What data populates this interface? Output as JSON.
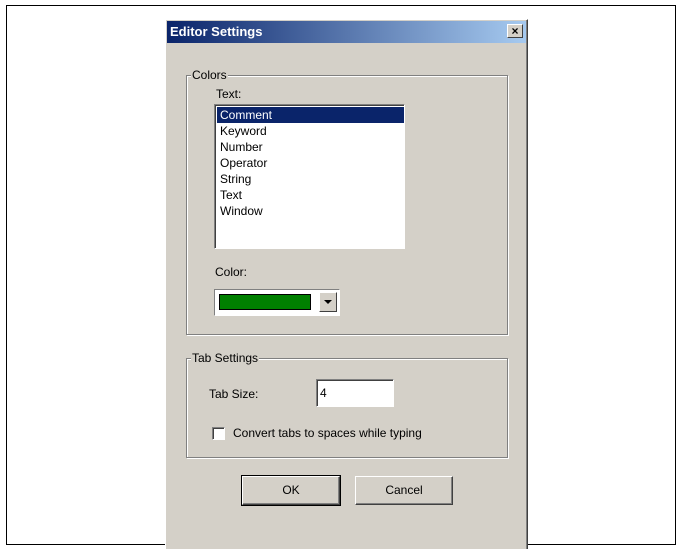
{
  "dialog": {
    "title": "Editor Settings",
    "close_label": "×"
  },
  "colors_group": {
    "label": "Colors",
    "text_label": "Text:",
    "items": [
      "Comment",
      "Keyword",
      "Number",
      "Operator",
      "String",
      "Text",
      "Window"
    ],
    "selected_index": 0,
    "color_label": "Color:",
    "selected_color": "#008000"
  },
  "tab_group": {
    "label": "Tab Settings",
    "tab_size_label": "Tab Size:",
    "tab_size_value": "4",
    "convert_label": "Convert tabs to spaces while typing",
    "convert_checked": false
  },
  "buttons": {
    "ok": "OK",
    "cancel": "Cancel"
  }
}
